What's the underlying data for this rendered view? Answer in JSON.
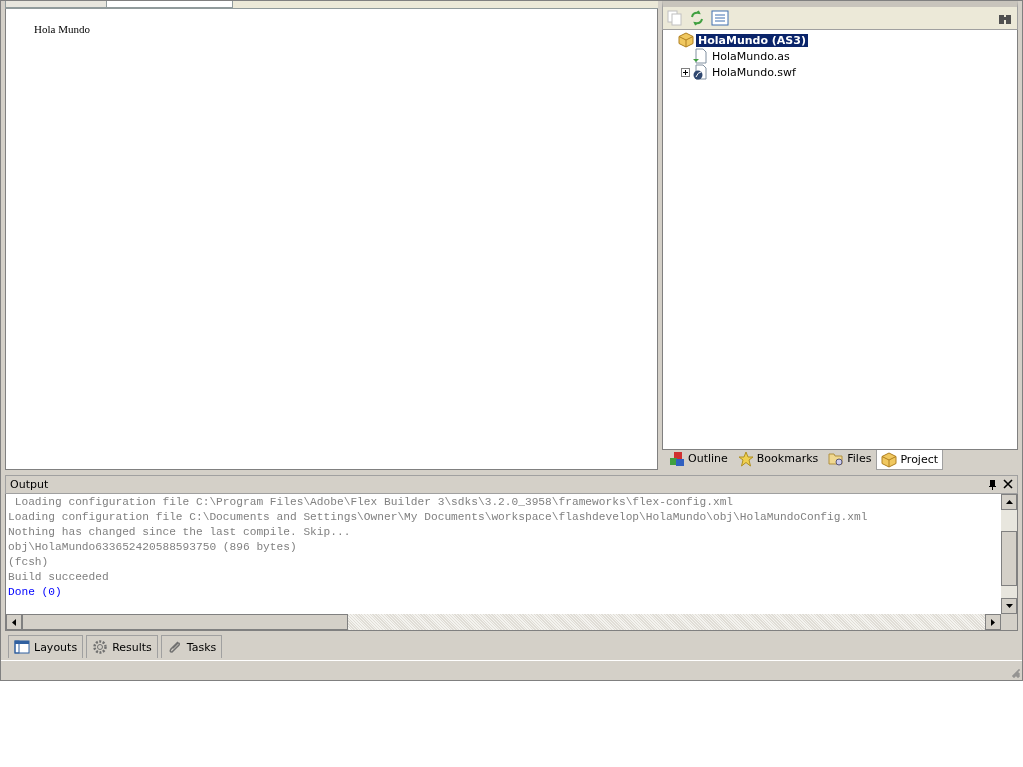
{
  "editor": {
    "tabs": [
      {
        "selected": false
      },
      {
        "selected": true
      }
    ],
    "content": "Hola Mundo"
  },
  "project_panel": {
    "tree": [
      {
        "label": "HolaMundo (AS3)",
        "kind": "project",
        "selected": true,
        "expanded": true,
        "children": [
          {
            "label": "HolaMundo.as",
            "kind": "as",
            "selected": false
          },
          {
            "label": "HolaMundo.swf",
            "kind": "swf",
            "selected": false,
            "expanded": false
          }
        ]
      }
    ],
    "tabs": [
      {
        "label": "Outline",
        "kind": "outline",
        "selected": false
      },
      {
        "label": "Bookmarks",
        "kind": "star",
        "selected": false
      },
      {
        "label": "Files",
        "kind": "files",
        "selected": false
      },
      {
        "label": "Project",
        "kind": "project",
        "selected": true
      }
    ]
  },
  "output": {
    "title": "Output",
    "lines": [
      {
        "text": " Loading configuration file C:\\Program Files\\Adobe\\Flex Builder 3\\sdks\\3.2.0_3958\\frameworks\\flex-config.xml",
        "color": "#808080"
      },
      {
        "text": "Loading configuration file C:\\Documents and Settings\\Owner\\My Documents\\workspace\\flashdevelop\\HolaMundo\\obj\\HolaMundoConfig.xml",
        "color": "#808080"
      },
      {
        "text": "Nothing has changed since the last compile. Skip...",
        "color": "#808080"
      },
      {
        "text": "obj\\HolaMundo633652420588593750 (896 bytes)",
        "color": "#808080"
      },
      {
        "text": "(fcsh)",
        "color": "#808080"
      },
      {
        "text": "Build succeeded",
        "color": "#808080"
      },
      {
        "text": "Done (0)",
        "color": "#0000ff"
      }
    ]
  },
  "bottom_tabs": [
    {
      "label": "Layouts",
      "kind": "layouts",
      "selected": false
    },
    {
      "label": "Results",
      "kind": "gear",
      "selected": false
    },
    {
      "label": "Tasks",
      "kind": "clip",
      "selected": false
    }
  ]
}
